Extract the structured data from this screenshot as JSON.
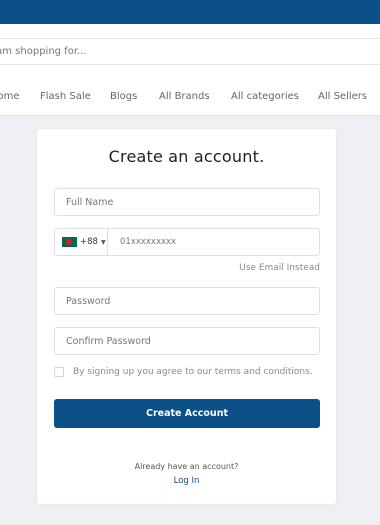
{
  "search": {
    "placeholder": "I am shopping for..."
  },
  "nav": {
    "items": [
      {
        "label": "Home"
      },
      {
        "label": "Flash Sale"
      },
      {
        "label": "Blogs"
      },
      {
        "label": "All Brands"
      },
      {
        "label": "All categories"
      },
      {
        "label": "All Sellers"
      }
    ]
  },
  "form": {
    "title": "Create an account.",
    "full_name_placeholder": "Full Name",
    "phone": {
      "country_code": "+88",
      "placeholder": "01xxxxxxxxx",
      "flag_icon": "bangladesh-flag-icon"
    },
    "use_email_label": "Use Email Instead",
    "password_placeholder": "Password",
    "confirm_password_placeholder": "Confirm Password",
    "terms_label": "By signing up you agree to our terms and conditions.",
    "submit_label": "Create Account",
    "already_label": "Already have an account?",
    "login_label": "Log In"
  },
  "colors": {
    "brand": "#0b4f88",
    "background": "#eef0f3"
  }
}
